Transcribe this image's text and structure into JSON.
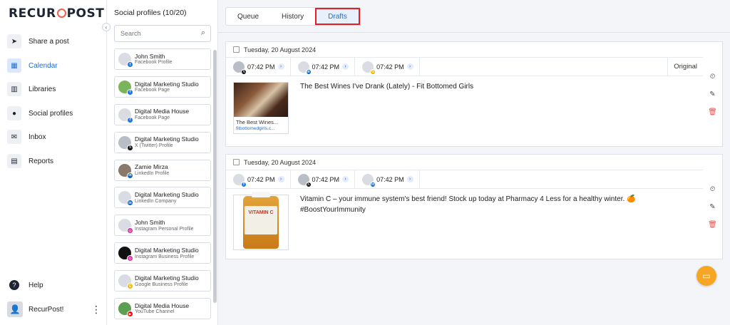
{
  "brand": {
    "logo_part1": "RECUR",
    "logo_part2": "POST",
    "accent": "#1f6fd1",
    "logo_accent": "#ef5f4d"
  },
  "nav": {
    "items": [
      {
        "label": "Share a post",
        "icon": "send-icon",
        "glyph": "➤"
      },
      {
        "label": "Calendar",
        "icon": "calendar-icon",
        "glyph": "▦",
        "active": true
      },
      {
        "label": "Libraries",
        "icon": "library-icon",
        "glyph": "▥"
      },
      {
        "label": "Social profiles",
        "icon": "profile-icon",
        "glyph": "●"
      },
      {
        "label": "Inbox",
        "icon": "inbox-icon",
        "glyph": "✉"
      },
      {
        "label": "Reports",
        "icon": "report-icon",
        "glyph": "▤"
      }
    ],
    "help": {
      "label": "Help",
      "icon": "help-icon",
      "glyph": "?"
    },
    "user": {
      "name": "RecurPost!",
      "icon": "user-avatar-icon",
      "menu_icon": "more-vertical-icon"
    }
  },
  "profiles": {
    "title": "Social profiles (10/20)",
    "search_placeholder": "Search",
    "items": [
      {
        "name": "John Smith",
        "type": "Facebook Profile",
        "network": "facebook",
        "color": "#1877f2",
        "avatar": "#d9dde3"
      },
      {
        "name": "Digital Marketing Studio",
        "type": "Facebook Page",
        "network": "facebook",
        "color": "#1877f2",
        "avatar": "#7ab55c"
      },
      {
        "name": "Digital Media House",
        "type": "Facebook Page",
        "network": "facebook",
        "color": "#1877f2",
        "avatar": "#d9dde3"
      },
      {
        "name": "Digital Marketing Studio",
        "type": "X (Twitter) Profile",
        "network": "x",
        "color": "#111111",
        "avatar": "#b9bec6"
      },
      {
        "name": "Zamie Mirza",
        "type": "LinkedIn Profile",
        "network": "linkedin",
        "color": "#0a66c2",
        "avatar": "#8a7a6a"
      },
      {
        "name": "Digital Marketing Studio",
        "type": "LinkedIn Company",
        "network": "linkedin",
        "color": "#0a66c2",
        "avatar": "#d9dde3"
      },
      {
        "name": "John Smith",
        "type": "Instagram Personal Profile",
        "network": "instagram",
        "color": "#d6249f",
        "avatar": "#d9dde3"
      },
      {
        "name": "Digital Marketing Studio",
        "type": "Instagram Business Profile",
        "network": "instagram",
        "color": "#d6249f",
        "avatar": "#111111"
      },
      {
        "name": "Digital Marketing Studio",
        "type": "Google Business Profile",
        "network": "google",
        "color": "#f4b400",
        "avatar": "#d9dde3"
      },
      {
        "name": "Digital Media House",
        "type": "YouTube Channel",
        "network": "youtube",
        "color": "#ff0000",
        "avatar": "#5aa050"
      }
    ]
  },
  "tabs": [
    {
      "label": "Queue"
    },
    {
      "label": "History"
    },
    {
      "label": "Drafts",
      "active": true
    }
  ],
  "posts": [
    {
      "date": "Tuesday, 20 August 2024",
      "chips": [
        {
          "time": "07:42 PM",
          "network": "x",
          "color": "#111111",
          "avatar": "#b9bec6"
        },
        {
          "time": "07:42 PM",
          "network": "linkedin",
          "color": "#0a66c2",
          "avatar": "#d9dde3"
        },
        {
          "time": "07:42 PM",
          "network": "google",
          "color": "#f4b400",
          "avatar": "#d9dde3"
        }
      ],
      "original_label": "Original",
      "text": "The Best Wines I've Drank (Lately) - Fit Bottomed Girls",
      "link_preview": {
        "title": "The Best Wines...",
        "domain": "fitbottomedgirls.c..."
      }
    },
    {
      "date": "Tuesday, 20 August 2024",
      "chips": [
        {
          "time": "07:42 PM",
          "network": "facebook",
          "color": "#1877f2",
          "avatar": "#d9dde3"
        },
        {
          "time": "07:42 PM",
          "network": "x",
          "color": "#111111",
          "avatar": "#b9bec6"
        },
        {
          "time": "07:42 PM",
          "network": "linkedin",
          "color": "#0a66c2",
          "avatar": "#d9dde3"
        }
      ],
      "text": "Vitamin C – your immune system's best friend! Stock up today at Pharmacy 4 Less for a healthy winter. 🍊 #BoostYourImmunity",
      "image_label": "VITAMIN C"
    }
  ],
  "actions": {
    "icons": [
      "schedule-icon",
      "edit-icon",
      "delete-icon"
    ]
  },
  "chat": {
    "icon": "chat-icon"
  }
}
